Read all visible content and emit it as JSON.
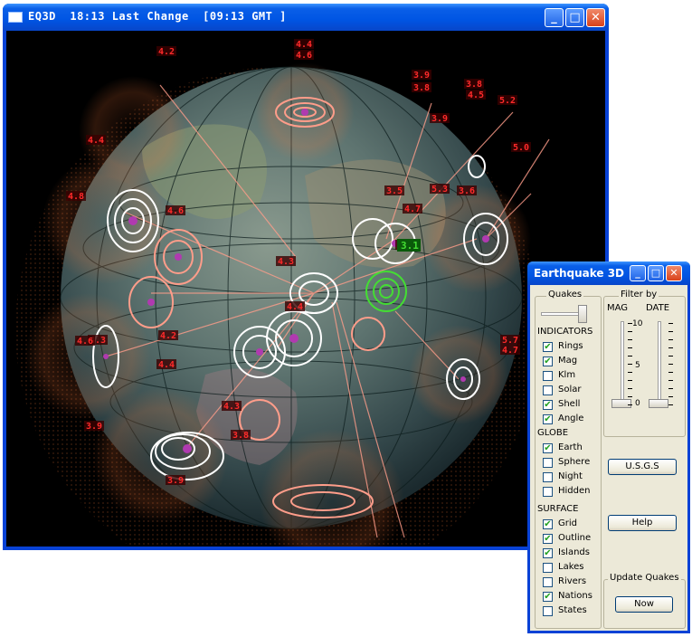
{
  "main_window": {
    "title": "EQ3D  18:13 Last Change  [09:13 GMT ]",
    "controls": {
      "minimize": "_",
      "maximize": "□",
      "close": "✕"
    }
  },
  "globe": {
    "labels": [
      "4.4",
      "4.6",
      "4.2",
      "3.9",
      "3.8",
      "4.5",
      "3.8",
      "5.2",
      "4.4",
      "5.0",
      "4.6",
      "3.9",
      "3.5",
      "4.8",
      "5.3",
      "3.1",
      "4.3",
      "4.4",
      "4.2",
      "4.3",
      "5.7",
      "4.7",
      "4.6",
      "4.4",
      "4.3",
      "3.9",
      "3.8",
      "3.9",
      "3.6",
      "4.7"
    ],
    "highlight_label": "3.1"
  },
  "dialog": {
    "title": "Earthquake 3D",
    "controls": {
      "minimize": "_",
      "maximize": "□",
      "close": "✕"
    },
    "quakes_label": "Quakes",
    "filter_label": "Filter by",
    "mag_label": "MAG",
    "date_label": "DATE",
    "scale": {
      "top": "10",
      "mid": "5",
      "bottom": "0"
    },
    "indicators_header": "INDICATORS",
    "indicators": [
      {
        "label": "Rings",
        "checked": true
      },
      {
        "label": "Mag",
        "checked": true
      },
      {
        "label": "Klm",
        "checked": false
      },
      {
        "label": "Solar",
        "checked": false
      },
      {
        "label": "Shell",
        "checked": true
      },
      {
        "label": "Angle",
        "checked": true
      }
    ],
    "globe_header": "GLOBE",
    "globe_opts": [
      {
        "label": "Earth",
        "checked": true
      },
      {
        "label": "Sphere",
        "checked": false
      },
      {
        "label": "Night",
        "checked": false
      },
      {
        "label": "Hidden",
        "checked": false
      }
    ],
    "surface_header": "SURFACE",
    "surface_opts": [
      {
        "label": "Grid",
        "checked": true
      },
      {
        "label": "Outline",
        "checked": true
      },
      {
        "label": "Islands",
        "checked": true
      },
      {
        "label": "Lakes",
        "checked": false
      },
      {
        "label": "Rivers",
        "checked": false
      },
      {
        "label": "Nations",
        "checked": true
      },
      {
        "label": "States",
        "checked": false
      }
    ],
    "usgs_label": "U.S.G.S",
    "help_label": "Help",
    "update_label": "Update Quakes",
    "now_label": "Now"
  },
  "colors": {
    "window_blue": "#0842d6",
    "ring_white": "#ffffff",
    "ring_salmon": "#ff9d8a",
    "dot_orange": "#ff7a3a",
    "label_red": "#ff2a2a",
    "label_box": "#3a0000",
    "highlight_green": "#44dd33"
  }
}
